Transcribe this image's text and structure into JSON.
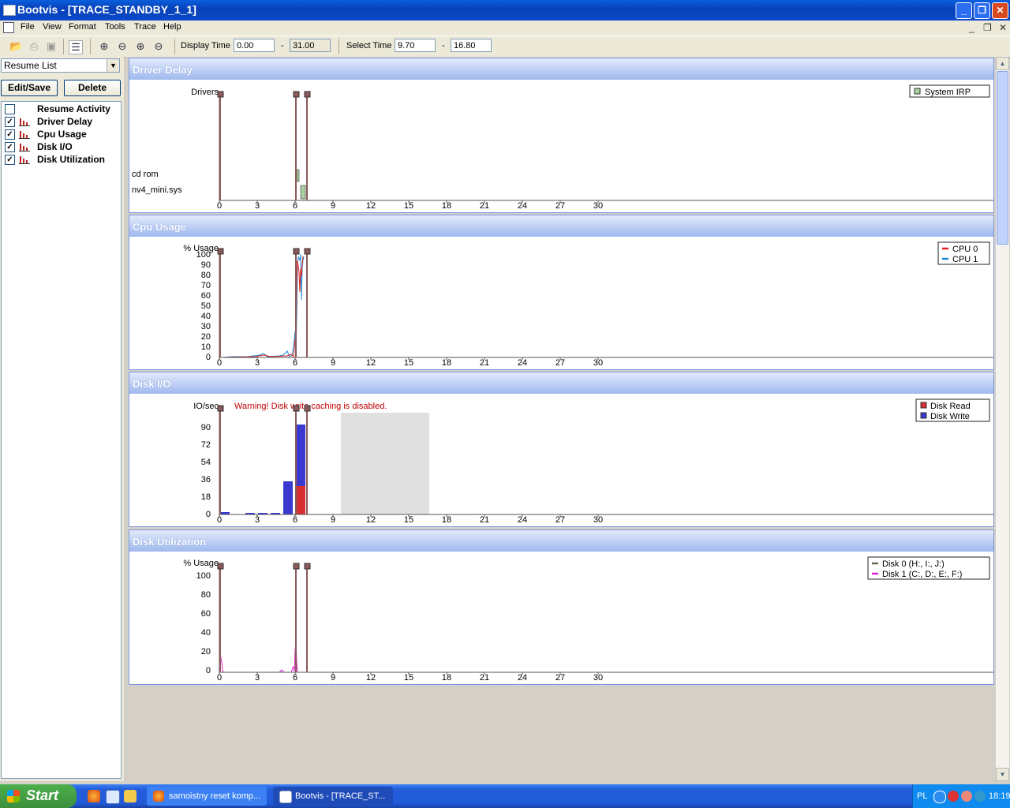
{
  "window": {
    "title": "Bootvis - [TRACE_STANDBY_1_1]"
  },
  "menu": [
    "File",
    "View",
    "Format",
    "Tools",
    "Trace",
    "Help"
  ],
  "toolbar": {
    "display_time_label": "Display Time",
    "display_time_from": "0.00",
    "dash": "-",
    "display_time_to": "31.00",
    "select_time_label": "Select Time",
    "select_time_from": "9.70",
    "select_time_to": "16.80"
  },
  "left_pane": {
    "combo_value": "Resume List",
    "edit_save": "Edit/Save",
    "delete": "Delete",
    "items": [
      {
        "label": "Resume Activity",
        "checked": false,
        "check_mark": ""
      },
      {
        "label": "Driver Delay",
        "checked": true,
        "check_mark": "✓"
      },
      {
        "label": "Cpu Usage",
        "checked": true,
        "check_mark": "✓"
      },
      {
        "label": "Disk I/O",
        "checked": true,
        "check_mark": "✓"
      },
      {
        "label": "Disk Utilization",
        "checked": true,
        "check_mark": "✓"
      }
    ]
  },
  "x_ticks": [
    "0",
    "3",
    "6",
    "9",
    "12",
    "15",
    "18",
    "21",
    "24",
    "27",
    "30"
  ],
  "panels": {
    "driver_delay": {
      "title": "Driver Delay",
      "y_title": "Drivers",
      "rows": [
        "cd rom",
        "nv4_mini.sys"
      ],
      "legend": [
        "System IRP"
      ]
    },
    "cpu_usage": {
      "title": "Cpu Usage",
      "y_title": "% Usage",
      "y_ticks": [
        "100",
        "90",
        "80",
        "70",
        "60",
        "50",
        "40",
        "30",
        "20",
        "10",
        "0"
      ],
      "legend": [
        "CPU 0",
        "CPU 1"
      ]
    },
    "disk_io": {
      "title": "Disk I/O",
      "y_title": "IO/sec",
      "warning": "Warning!  Disk write caching is disabled.",
      "y_ticks": [
        "90",
        "72",
        "54",
        "36",
        "18",
        "0"
      ],
      "legend": [
        "Disk Read",
        "Disk Write"
      ]
    },
    "disk_util": {
      "title": "Disk Utilization",
      "y_title": "% Usage",
      "y_ticks": [
        "100",
        "80",
        "60",
        "40",
        "20",
        "0"
      ],
      "legend": [
        "Disk 0 (H:, I:, J:)",
        "Disk 1 (C:, D:, E:, F:)"
      ]
    }
  },
  "colors": {
    "cpu0": "#e02020",
    "cpu1": "#1a8ad8",
    "disk_read": "#d83030",
    "disk_write": "#3a3ad0",
    "disk0": "#6a6a50",
    "disk1": "#e020d0",
    "marker": "#8b5a5a",
    "irp": "#a8d0a0"
  },
  "taskbar": {
    "start": "Start",
    "tasks": [
      "samoistny reset komp...",
      "Bootvis - [TRACE_ST..."
    ],
    "lang": "PL",
    "clock": "18:19"
  }
}
